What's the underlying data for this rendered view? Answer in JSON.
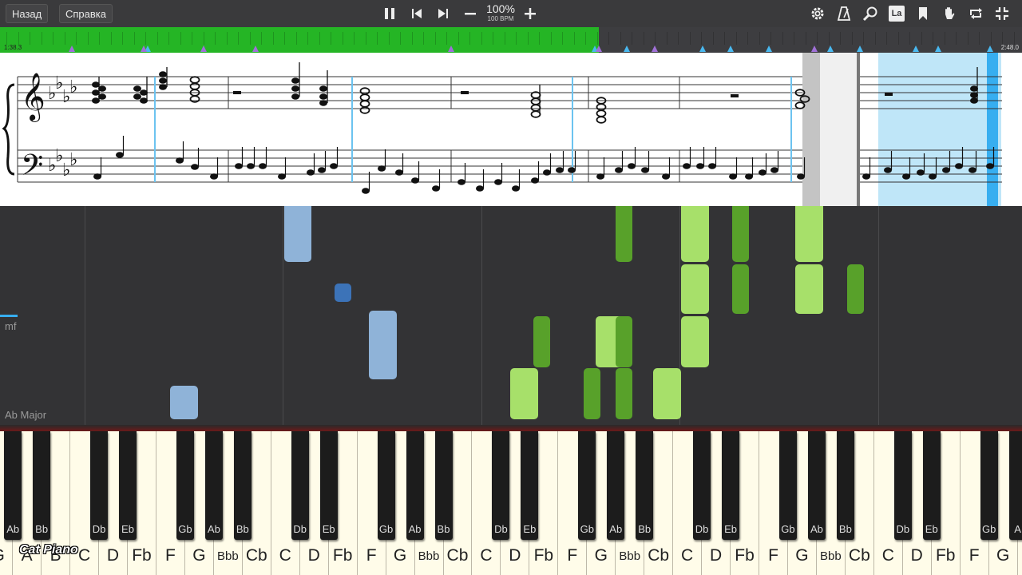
{
  "toolbar": {
    "back_label": "Назад",
    "help_label": "Справка",
    "tempo_percent": "100%",
    "tempo_bpm": "100 BPM",
    "language_badge": "La",
    "icons": [
      "pause-icon",
      "skip-back-icon",
      "skip-forward-icon",
      "minus-icon",
      "plus-icon",
      "gear-icon",
      "metronome-icon",
      "magnifier-icon",
      "language-icon",
      "bookmark-icon",
      "hand-icon",
      "loop-icon",
      "exit-fullscreen-icon"
    ]
  },
  "timeline": {
    "current_time": "1:38.3",
    "total_time": "2:48.0",
    "progress": 0.586
  },
  "roll": {
    "dynamic_mark": "mf",
    "key_signature": "Ab Major"
  },
  "keyboard": {
    "white_keys": [
      "G",
      "A",
      "B",
      "C",
      "D",
      "Fb",
      "F",
      "G",
      "Bbb",
      "Cb",
      "C",
      "D",
      "Fb",
      "F",
      "G",
      "Bbb",
      "Cb",
      "C",
      "D",
      "Fb",
      "F",
      "G",
      "Bbb",
      "Cb",
      "C",
      "D",
      "Fb",
      "F",
      "G",
      "Bbb",
      "Cb",
      "C",
      "D",
      "Fb",
      "F",
      "G"
    ],
    "black_keys": [
      "Ab",
      "Bb",
      "Db",
      "Eb",
      "Gb",
      "Ab",
      "Bb",
      "Db",
      "Eb",
      "Gb",
      "Ab",
      "Bb",
      "Db",
      "Eb",
      "Gb",
      "Ab",
      "Bb",
      "Db",
      "Eb",
      "Gb",
      "Ab",
      "Bb",
      "Db",
      "Eb",
      "Gb",
      "A"
    ]
  },
  "brand": "Cat Piano",
  "colors": {
    "played": "#25b525",
    "marker_blue": "#49b8ef",
    "marker_purple": "#a070d8",
    "left_hand_note": "#8fb3d8",
    "right_hand_light": "#a7e06a",
    "right_hand_dark": "#58a12a",
    "highlight": "#bfe6f8"
  }
}
